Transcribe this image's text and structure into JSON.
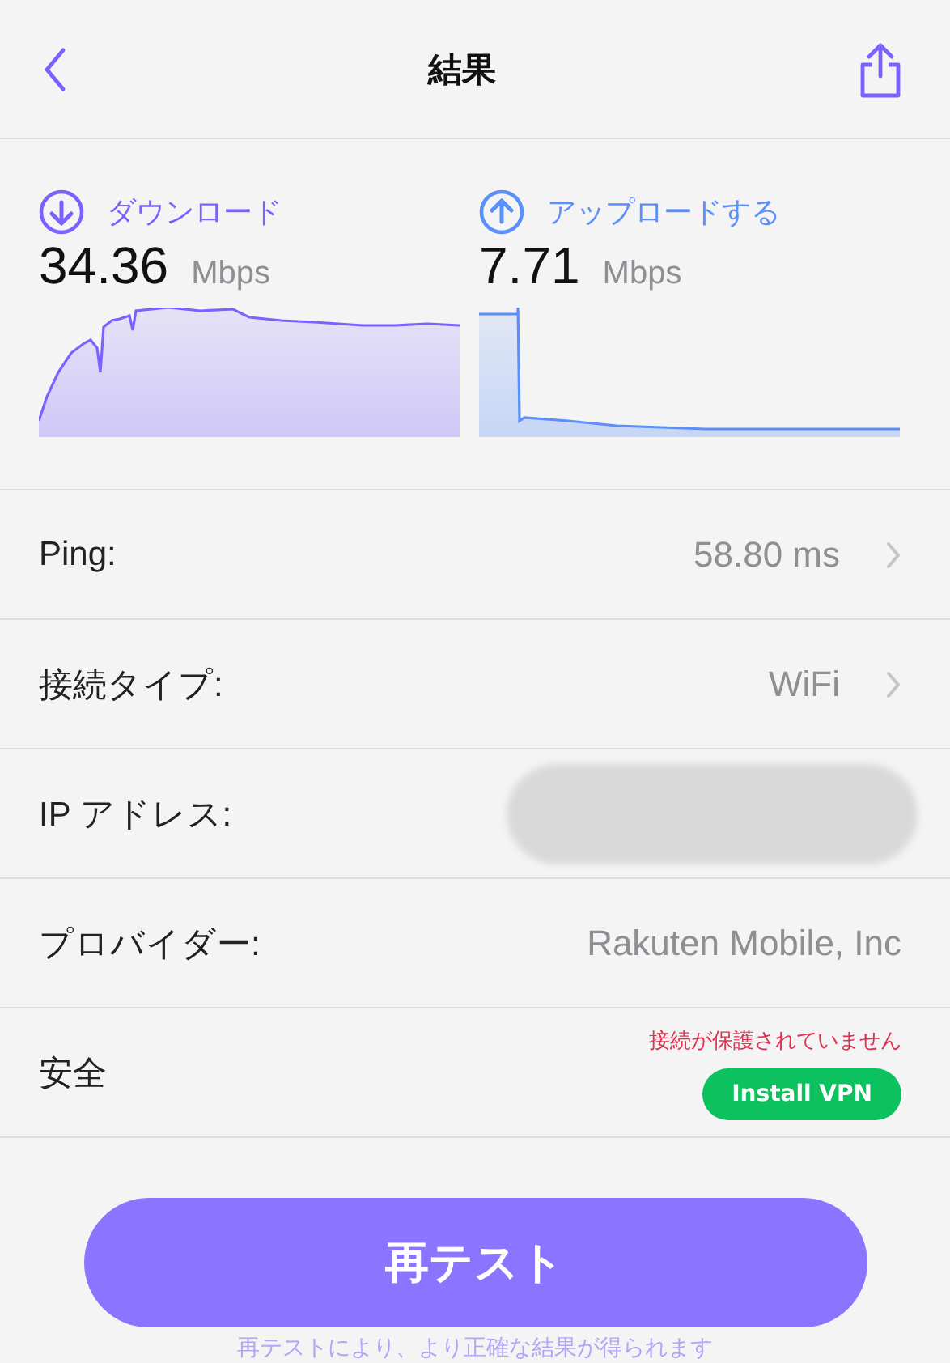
{
  "header": {
    "title": "結果"
  },
  "speeds": [
    {
      "kind": "download",
      "label": "ダウンロード",
      "value": "34.36",
      "unit": "Mbps",
      "color": "#7b61ff"
    },
    {
      "kind": "upload",
      "label": "アップロードする",
      "value": "7.71",
      "unit": "Mbps",
      "color": "#5b8ff9"
    }
  ],
  "rows": [
    {
      "kind": "link",
      "label": "Ping:",
      "value": "58.80 ms"
    },
    {
      "kind": "link",
      "label": "接続タイプ:",
      "value": "WiFi"
    },
    {
      "kind": "hidden",
      "label": "IP アドレス:"
    },
    {
      "kind": "plain",
      "label": "プロバイダー:",
      "value": "Rakuten Mobile, Inc"
    },
    {
      "kind": "security",
      "label": "安全",
      "warning": "接続が保護されていません",
      "button": "Install VPN"
    }
  ],
  "retest": {
    "button": "再テスト",
    "hint": "再テストにより、より正確な結果が得られます"
  }
}
